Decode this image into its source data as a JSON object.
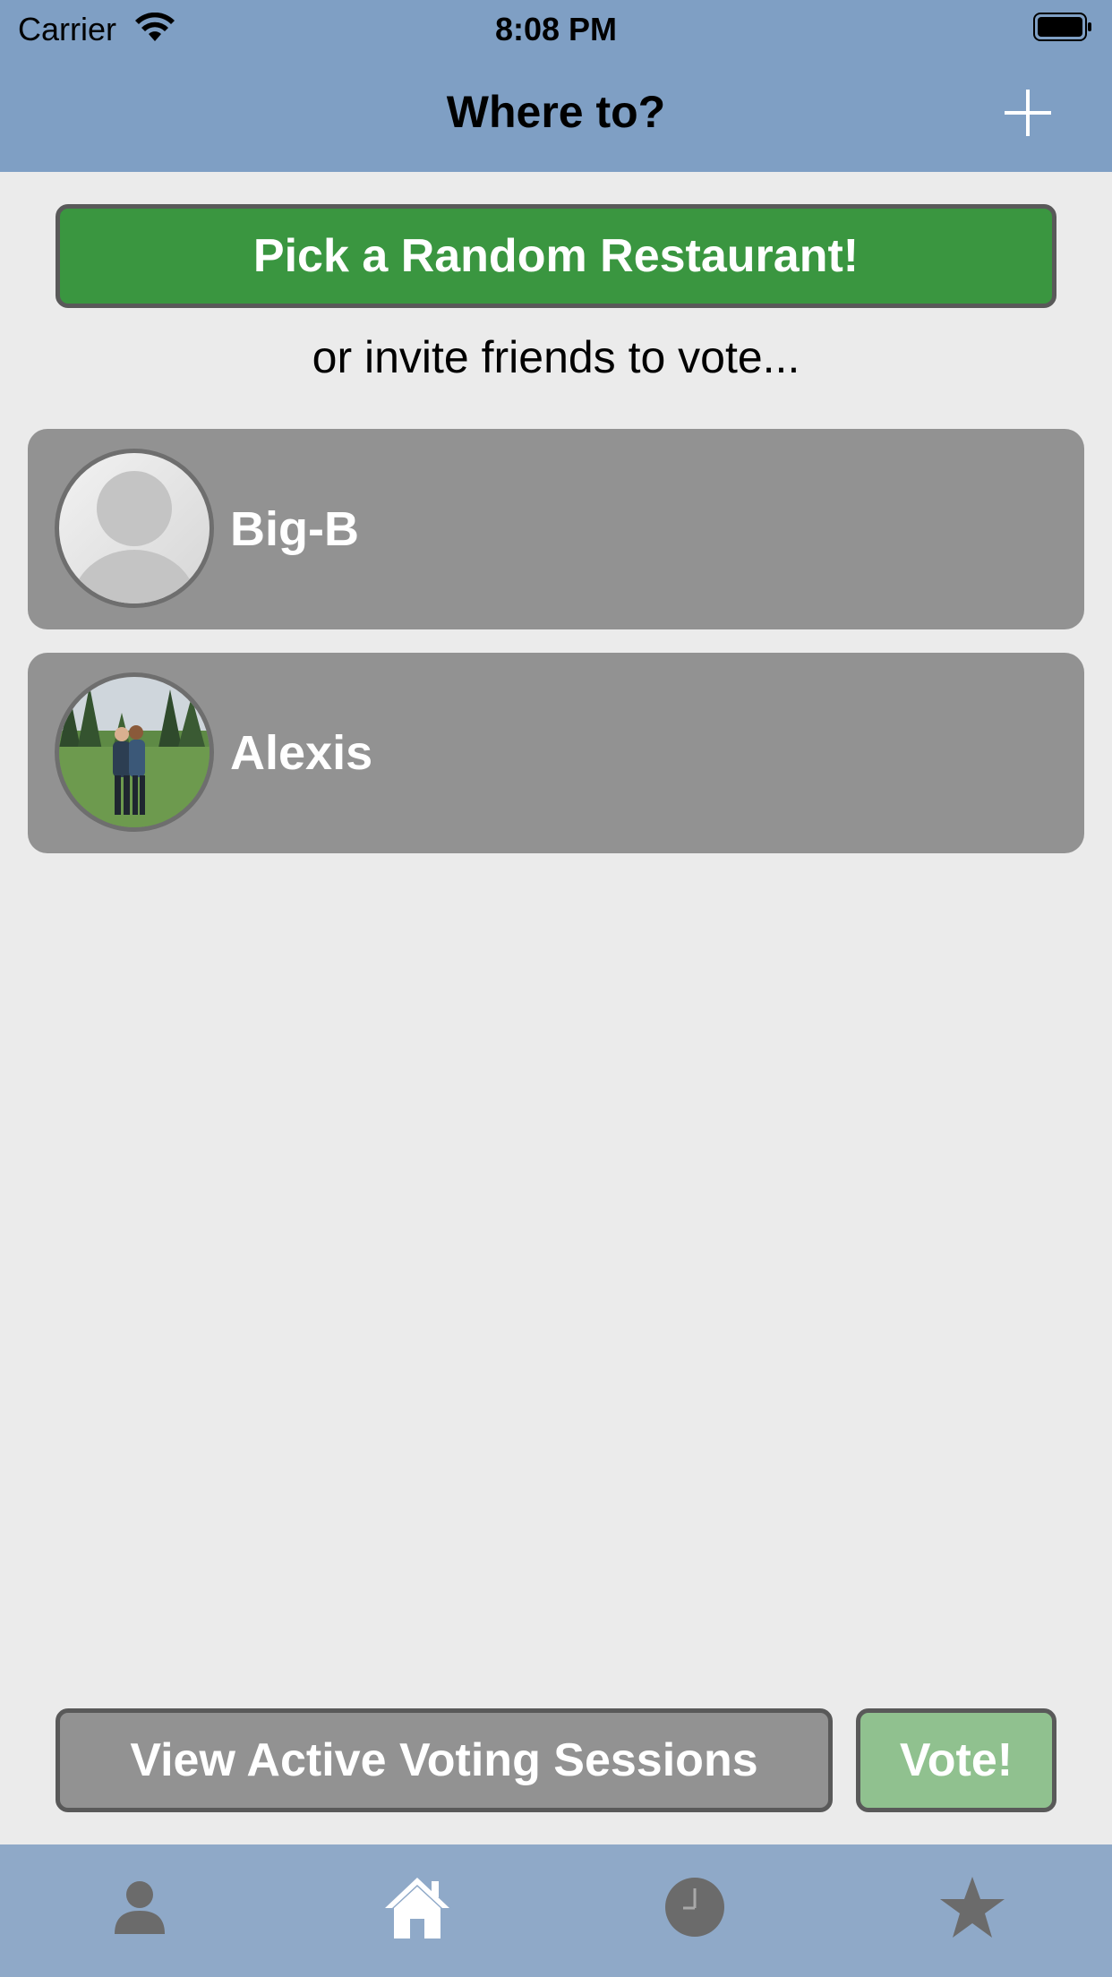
{
  "status_bar": {
    "carrier": "Carrier",
    "time": "8:08 PM",
    "wifi_icon": "wifi-icon",
    "battery_icon": "battery-icon"
  },
  "nav": {
    "title": "Where to?",
    "add_icon": "plus-icon"
  },
  "main": {
    "random_button_label": "Pick a Random Restaurant!",
    "invite_text": "or invite friends to vote..."
  },
  "friends": [
    {
      "name": "Big-B",
      "avatar": "default-avatar-icon"
    },
    {
      "name": "Alexis",
      "avatar": "photo-avatar"
    }
  ],
  "actions": {
    "sessions_label": "View Active Voting Sessions",
    "vote_label": "Vote!"
  },
  "tabbar": {
    "items": [
      "person-icon",
      "home-icon",
      "clock-icon",
      "star-icon"
    ]
  },
  "colors": {
    "nav_bg": "#7f9fc4",
    "tabbar_bg": "#8fa9c8",
    "random_btn": "#3a9640",
    "vote_btn": "#90c18f",
    "row_bg": "#929292",
    "page_bg": "#ebebeb"
  }
}
